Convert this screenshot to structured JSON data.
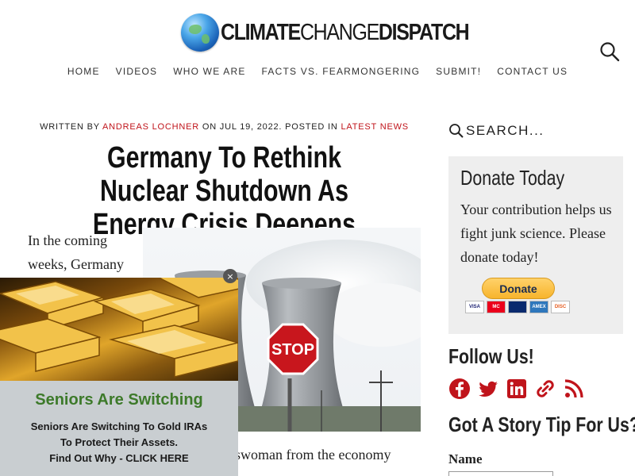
{
  "site": {
    "logo_main": "CLIMATE",
    "logo_thin": "CHANGE",
    "logo_end": "DISPATCH",
    "logo_icon": "globe-icon"
  },
  "nav": {
    "items": [
      {
        "label": "HOME"
      },
      {
        "label": "VIDEOS"
      },
      {
        "label": "WHO WE ARE"
      },
      {
        "label": "FACTS VS. FEARMONGERING"
      },
      {
        "label": "SUBMIT!"
      },
      {
        "label": "CONTACT US"
      }
    ]
  },
  "article": {
    "written_by": "WRITTEN BY",
    "author": "ANDREAS LOCHNER",
    "on": "ON JUL 19, 2022. POSTED IN",
    "category": "LATEST NEWS",
    "title": "Germany To Rethink Nuclear Shutdown As Energy Crisis Deepens",
    "lead": "In the coming weeks, Germany",
    "tail_text": "eswoman from the economy",
    "image_stop_sign": "STOP"
  },
  "sidebar": {
    "search_placeholder": "SEARCH...",
    "donate": {
      "title": "Donate Today",
      "body": "Your contribution helps us fight junk science. Please donate today!",
      "button": "Donate",
      "cards": [
        "VISA",
        "MC",
        "AMEX",
        "DISC"
      ]
    },
    "follow_title": "Follow Us!",
    "social_icons": [
      "facebook-icon",
      "twitter-icon",
      "linkedin-icon",
      "link-icon",
      "rss-icon"
    ],
    "tip_title": "Got A Story Tip For Us?",
    "name_label": "Name"
  },
  "ad": {
    "headline": "Seniors Are Switching",
    "line1": "Seniors Are Switching To Gold IRAs",
    "line2": "To Protect Their Assets.",
    "line3": "Find Out Why - CLICK HERE",
    "close": "×"
  },
  "colors": {
    "accent_red": "#c0141b",
    "donate_bg": "#eeeeee",
    "social_red": "#c0141b",
    "ad_green": "#3d7a2a"
  }
}
